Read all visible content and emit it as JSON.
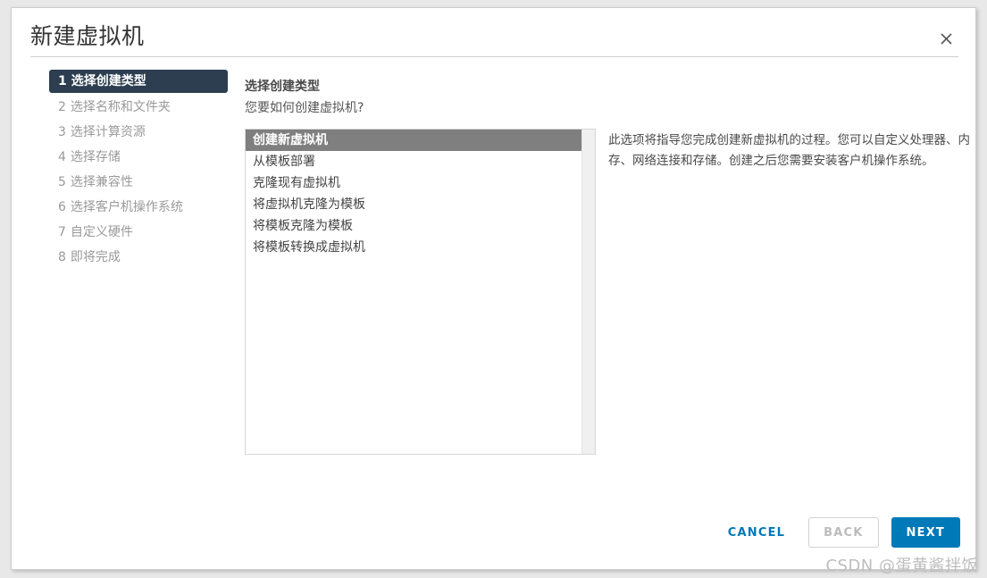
{
  "dialog": {
    "title": "新建虚拟机",
    "close_icon": "close-icon"
  },
  "sidebar": {
    "steps": [
      {
        "num": "1",
        "label": "选择创建类型",
        "active": true
      },
      {
        "num": "2",
        "label": "选择名称和文件夹",
        "active": false
      },
      {
        "num": "3",
        "label": "选择计算资源",
        "active": false
      },
      {
        "num": "4",
        "label": "选择存储",
        "active": false
      },
      {
        "num": "5",
        "label": "选择兼容性",
        "active": false
      },
      {
        "num": "6",
        "label": "选择客户机操作系统",
        "active": false
      },
      {
        "num": "7",
        "label": "自定义硬件",
        "active": false
      },
      {
        "num": "8",
        "label": "即将完成",
        "active": false
      }
    ]
  },
  "content": {
    "heading": "选择创建类型",
    "subheading": "您要如何创建虚拟机?",
    "options": [
      {
        "label": "创建新虚拟机",
        "selected": true
      },
      {
        "label": "从模板部署",
        "selected": false
      },
      {
        "label": "克隆现有虚拟机",
        "selected": false
      },
      {
        "label": "将虚拟机克隆为模板",
        "selected": false
      },
      {
        "label": "将模板克隆为模板",
        "selected": false
      },
      {
        "label": "将模板转换成虚拟机",
        "selected": false
      }
    ],
    "description": "此选项将指导您完成创建新虚拟机的过程。您可以自定义处理器、内存、网络连接和存储。创建之后您需要安装客户机操作系统。"
  },
  "footer": {
    "cancel_label": "CANCEL",
    "back_label": "BACK",
    "next_label": "NEXT"
  },
  "watermark": "CSDN @蛋黄酱拌饭",
  "colors": {
    "accent": "#0079b8",
    "step_active_bg": "#2c3e4f",
    "list_selected_bg": "#7f7f7f",
    "panel_border": "#d7d7d7",
    "scrollbar_track": "#f0f0f0"
  }
}
